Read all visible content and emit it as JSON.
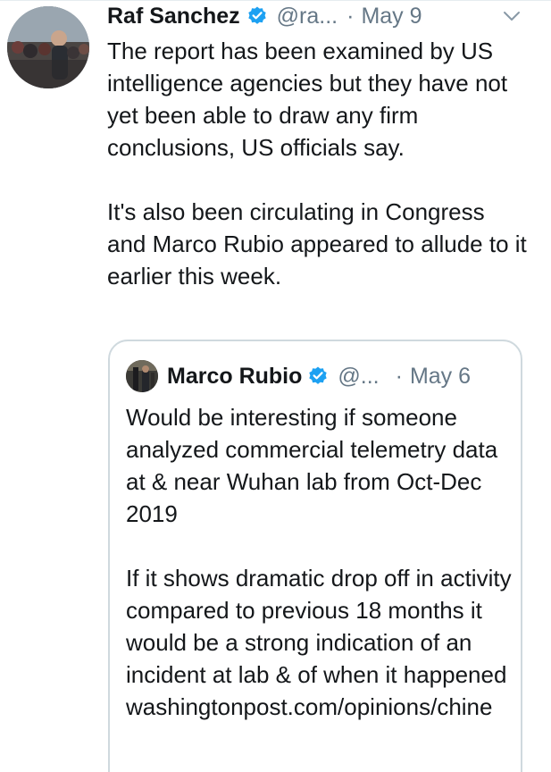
{
  "tweet": {
    "author_name": "Raf Sanchez",
    "handle": "@ra...",
    "separator": "·",
    "date": "May 9",
    "paragraphs": [
      "The report has been examined by US intelligence agencies but they have not yet been able to draw any firm conclusions, US officials say.",
      "It's also been circulating in Congress and Marco Rubio appeared to allude to it earlier this week."
    ],
    "verified": true,
    "icons": {
      "verified": "verified-badge-icon",
      "menu": "chevron-down-icon"
    }
  },
  "quoted_tweet": {
    "author_name": "Marco Rubio",
    "handle": "@...",
    "separator": "·",
    "date": "May 6",
    "paragraphs": [
      "Would be interesting if someone analyzed commercial telemetry data at & near Wuhan lab from Oct-Dec 2019",
      "If it shows dramatic drop off in activity compared to previous 18 months it would be a strong indication of an incident at lab & of when it happened washingtonpost.com/opinions/chine"
    ],
    "verified": true
  },
  "colors": {
    "text": "#14171a",
    "secondary": "#657786",
    "verified_blue": "#1da1f2",
    "border": "#cfd9de"
  }
}
